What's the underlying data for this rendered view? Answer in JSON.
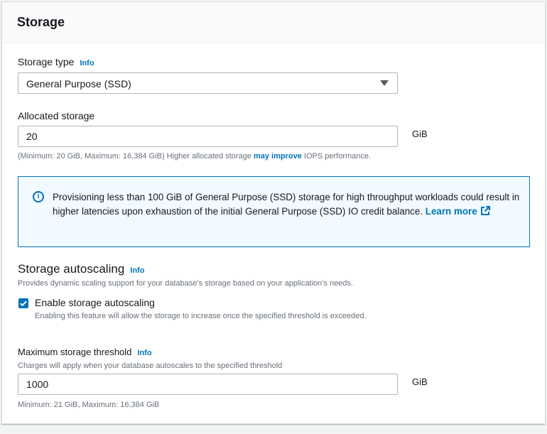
{
  "panel": {
    "title": "Storage"
  },
  "storage_type": {
    "label": "Storage type",
    "info": "Info",
    "selected": "General Purpose (SSD)"
  },
  "allocated_storage": {
    "label": "Allocated storage",
    "value": "20",
    "unit": "GiB",
    "hint_prefix": "(Minimum: 20 GiB, Maximum: 16,384 GiB) Higher allocated storage ",
    "hint_bold": "may improve",
    "hint_suffix": " IOPS performance."
  },
  "alert": {
    "text": "Provisioning less than 100 GiB of General Purpose (SSD) storage for high throughput workloads could result in higher latencies upon exhaustion of the initial General Purpose (SSD) IO credit balance. ",
    "link": "Learn more",
    "icon": "info-circle-icon",
    "accent": "#0073bb"
  },
  "autoscaling": {
    "title": "Storage autoscaling",
    "info": "Info",
    "description": "Provides dynamic scaling support for your database's storage based on your application's needs.",
    "checkbox_label": "Enable storage autoscaling",
    "checkbox_checked": true,
    "checkbox_help": "Enabling this feature will allow the storage to increase once the specified threshold is exceeded."
  },
  "max_threshold": {
    "label": "Maximum storage threshold",
    "info": "Info",
    "description": "Charges will apply when your database autoscales to the specified threshold",
    "value": "1000",
    "unit": "GiB",
    "hint": "Minimum: 21 GiB, Maximum: 16,384 GiB"
  }
}
